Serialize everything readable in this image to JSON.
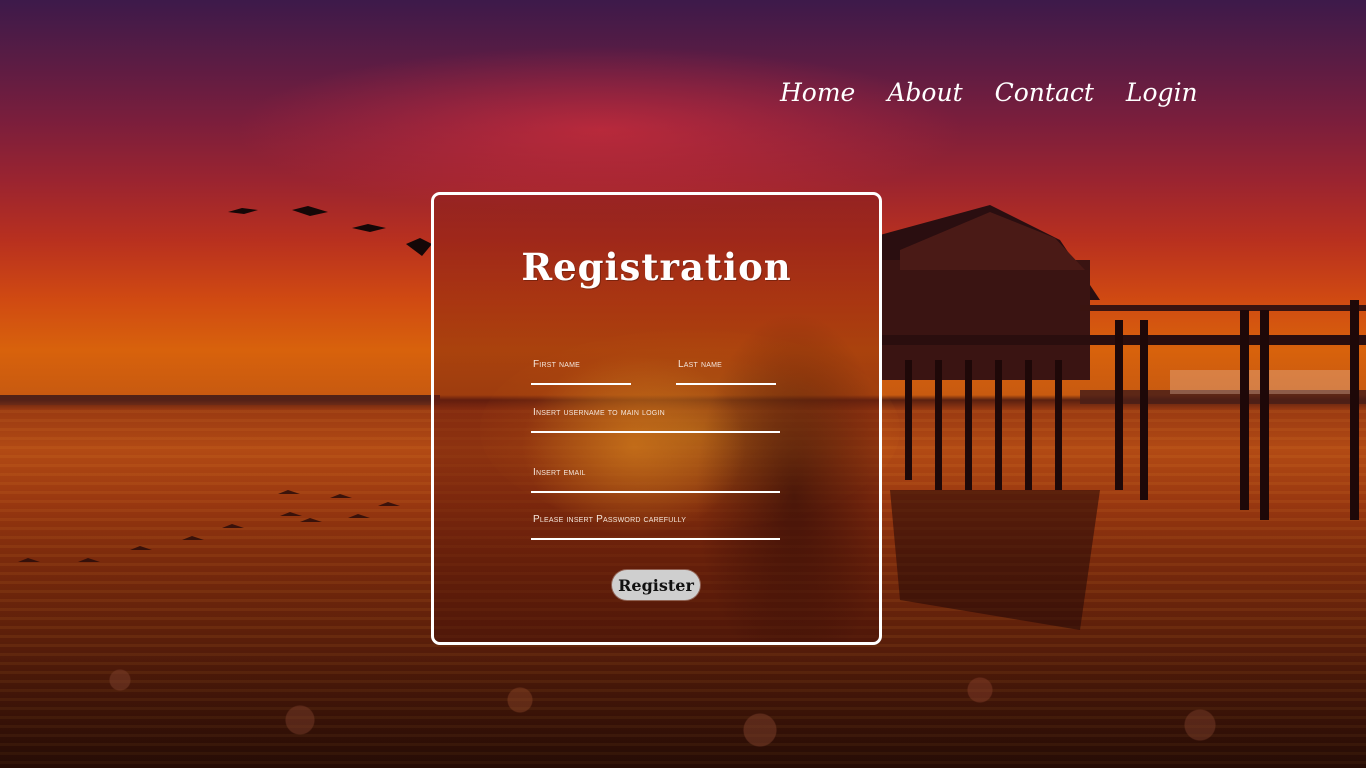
{
  "nav": {
    "items": [
      {
        "label": "Home"
      },
      {
        "label": "About"
      },
      {
        "label": "Contact"
      },
      {
        "label": "Login"
      }
    ]
  },
  "registration": {
    "title": "Registration",
    "fields": {
      "first_name": {
        "placeholder": "First name",
        "value": ""
      },
      "last_name": {
        "placeholder": "Last name",
        "value": ""
      },
      "username": {
        "placeholder": "Insert username to main login",
        "value": ""
      },
      "email": {
        "placeholder": "Insert email",
        "value": ""
      },
      "password": {
        "placeholder": "Please insert Password carefully",
        "value": ""
      }
    },
    "submit_label": "Register"
  },
  "colors": {
    "text": "#ffffff",
    "card_border": "#ffffff",
    "button_bg": "#cfcfcf",
    "button_text": "#111111",
    "sky_top": "#3d1a4a",
    "sky_mid": "#9a2430",
    "sunset_orange": "#d8620c"
  }
}
